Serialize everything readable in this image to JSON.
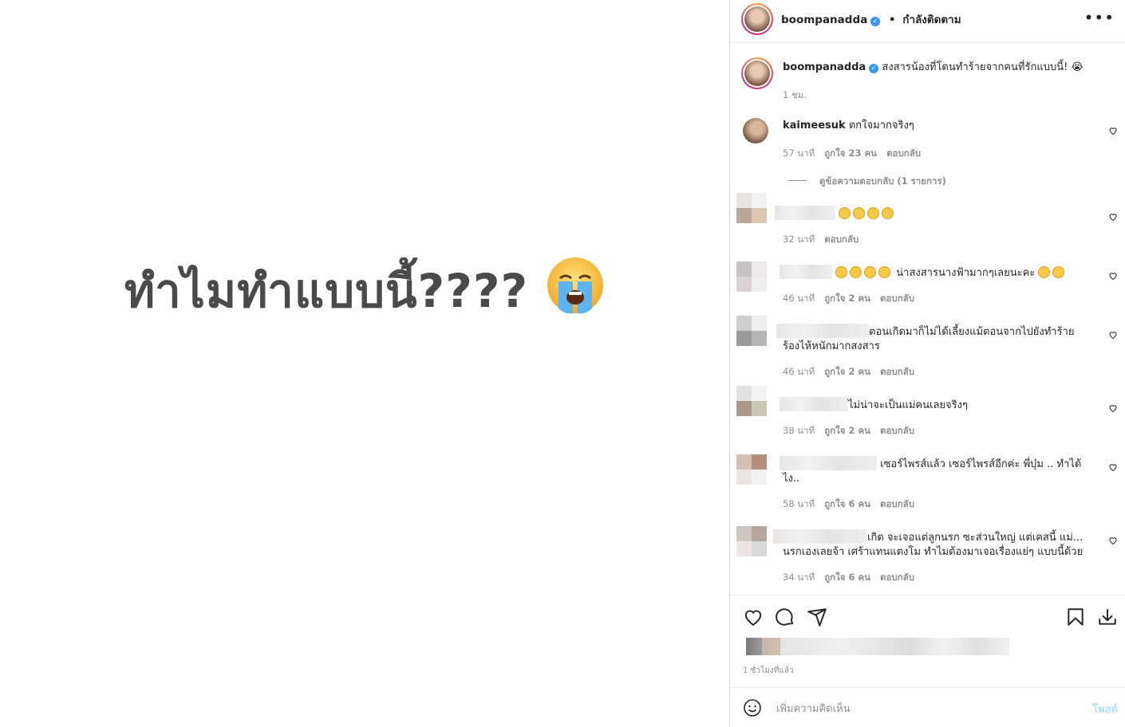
{
  "media": {
    "text": "ทำไมทำแบบนี้????",
    "emoji_icon": "loudly-crying-face-icon"
  },
  "header": {
    "username": "boompanadda",
    "separator": "•",
    "follow_status": "กำลังติดตาม",
    "more_icon": "more-options-icon"
  },
  "caption": {
    "username": "boompanadda",
    "text": "สงสารน้องที่โดนทำร้ายจากคนที่รักแบบนี้!",
    "time": "1 ชม."
  },
  "comments": [
    {
      "username": "kaimeesuk",
      "text": "ตกใจมากจริงๆ",
      "time": "57 นาที",
      "likes": "ถูกใจ 23 คน",
      "reply": "ตอบกลับ",
      "view_replies": "ดูข้อความตอบกลับ (1 รายการ)"
    },
    {
      "text": "",
      "time": "32 นาที",
      "likes": "",
      "reply": "ตอบกลับ"
    },
    {
      "text": "น่าสงสารนางฟ้ามากๆเลยนะคะ",
      "time": "46 นาที",
      "likes": "ถูกใจ 2 คน",
      "reply": "ตอบกลับ"
    },
    {
      "text": "ตอนเกิดมาก็ไม่ได้เลี้ยงแม้ตอนจากไปยังทำร้าย",
      "text2": "ร้องไห้หนักมากสงสาร",
      "time": "46 นาที",
      "likes": "ถูกใจ 2 คน",
      "reply": "ตอบกลับ"
    },
    {
      "text": "ไม่น่าจะเป็นแม่คนเลยจริงๆ",
      "time": "38 นาที",
      "likes": "ถูกใจ 2 คน",
      "reply": "ตอบกลับ"
    },
    {
      "text": "เซอร์ไพรส์แล้ว เซอร์ไพรส์อีกค่ะ พี่บุ๋ม .. ทำได้",
      "text2": "ไง..",
      "time": "58 นาที",
      "likes": "ถูกใจ 6 คน",
      "reply": "ตอบกลับ"
    },
    {
      "text": "เกิด จะเจอแต่ลูกนรก ซะส่วนใหญ่ แต่เคสนี้ แม่...",
      "text2": "นรกเองเลยจ้า เศร้าแทนแตงโม ทำไมต้องมาเจอเรื่องแย่ๆ แบบนี้ด้วย",
      "time": "34 นาที",
      "likes": "ถูกใจ 6 คน",
      "reply": "ตอบกลับ"
    }
  ],
  "footer": {
    "time_ago": "1 ชั่วโมงที่แล้ว",
    "comment_placeholder": "เพิ่มความคิดเห็น",
    "post_label": "โพสต์"
  }
}
